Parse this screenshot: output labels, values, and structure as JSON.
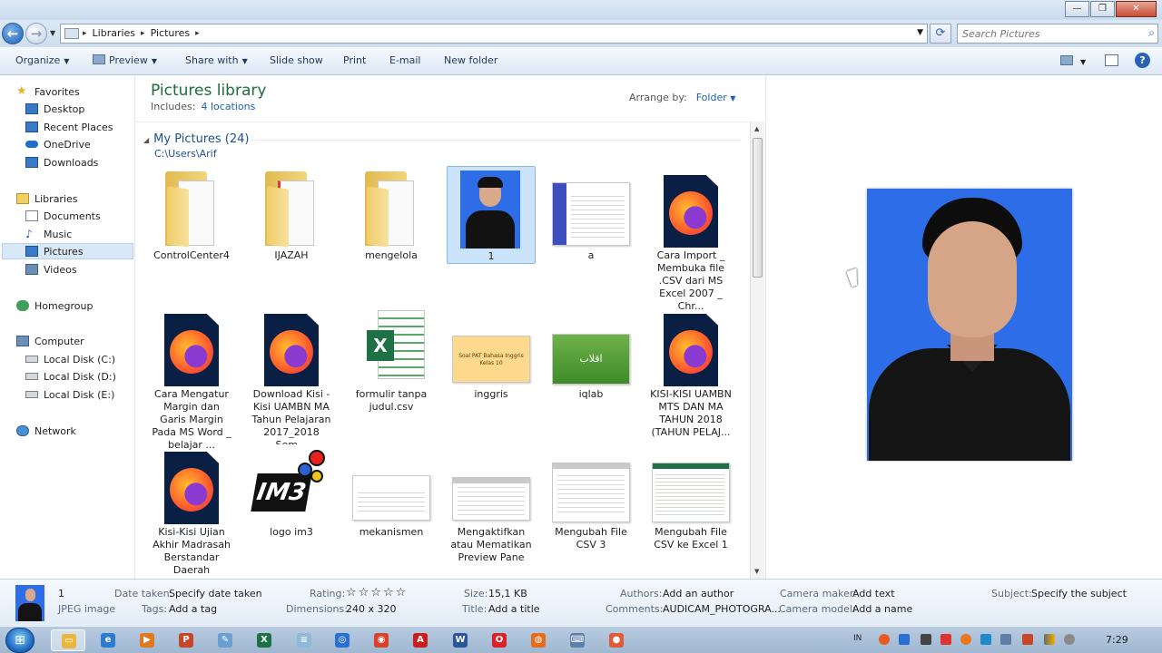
{
  "window": {
    "minimize": "—",
    "maximize": "❐",
    "close": "✕"
  },
  "address": {
    "crumbs": [
      "Libraries",
      "Pictures"
    ],
    "search_placeholder": "Search Pictures"
  },
  "toolbar": {
    "organize": "Organize",
    "preview": "Preview",
    "share_with": "Share with",
    "slide_show": "Slide show",
    "print": "Print",
    "email": "E-mail",
    "new_folder": "New folder",
    "help": "?"
  },
  "navpane": {
    "favorites": "Favorites",
    "desktop": "Desktop",
    "recent_places": "Recent Places",
    "onedrive": "OneDrive",
    "downloads": "Downloads",
    "libraries": "Libraries",
    "documents": "Documents",
    "music": "Music",
    "pictures": "Pictures",
    "videos": "Videos",
    "homegroup": "Homegroup",
    "computer": "Computer",
    "disk_c": "Local Disk (C:)",
    "disk_d": "Local Disk (D:)",
    "disk_e": "Local Disk (E:)",
    "network": "Network"
  },
  "content": {
    "title": "Pictures library",
    "includes_label": "Includes:",
    "includes_link": "4 locations",
    "arrange_label": "Arrange by:",
    "arrange_value": "Folder",
    "group_title": "My Pictures (24)",
    "group_path": "C:\\Users\\Arif",
    "files": [
      {
        "name": "ControlCenter4",
        "type": "folder"
      },
      {
        "name": "IJAZAH",
        "type": "folder"
      },
      {
        "name": "mengelola",
        "type": "folder"
      },
      {
        "name": "1",
        "type": "photo"
      },
      {
        "name": "a",
        "type": "screenshot"
      },
      {
        "name": "Cara Import _ Membuka file .CSV dari MS Excel 2007 _ Chr...",
        "type": "firefox"
      },
      {
        "name": "Cara Mengatur Margin dan Garis Margin Pada MS Word _ belajar ...",
        "type": "firefox"
      },
      {
        "name": "Download Kisi - Kisi UAMBN MA Tahun Pelajaran 2017_2018 Sem...",
        "type": "firefox"
      },
      {
        "name": "formulir tanpa judul.csv",
        "type": "excel"
      },
      {
        "name": "inggris",
        "type": "image"
      },
      {
        "name": "iqlab",
        "type": "image"
      },
      {
        "name": "KISI-KISI UAMBN MTS DAN MA TAHUN 2018 (TAHUN PELAJ...",
        "type": "firefox"
      },
      {
        "name": "Kisi-Kisi Ujian Akhir Madrasah Berstandar Daerah (UAMB...",
        "type": "firefox"
      },
      {
        "name": "logo im3",
        "type": "logo"
      },
      {
        "name": "mekanismen",
        "type": "image"
      },
      {
        "name": "Mengaktifkan atau Mematikan Preview Pane",
        "type": "screenshot"
      },
      {
        "name": "Mengubah File CSV 3",
        "type": "screenshot"
      },
      {
        "name": "Mengubah File CSV ke Excel 1",
        "type": "screenshot"
      }
    ],
    "inggris_text": "Soal PAT Bahasa Inggris Kelas 10",
    "iqlab_text": "اقلاب",
    "im3_text": "IM3"
  },
  "details": {
    "name": "1",
    "filetype": "JPEG image",
    "date_taken_label": "Date taken:",
    "date_taken_value": "Specify date taken",
    "tags_label": "Tags:",
    "tags_value": "Add a tag",
    "rating_label": "Rating:",
    "rating_value": "☆☆☆☆☆",
    "dimensions_label": "Dimensions:",
    "dimensions_value": "240 x 320",
    "size_label": "Size:",
    "size_value": "15,1 KB",
    "title_label": "Title:",
    "title_value": "Add a title",
    "authors_label": "Authors:",
    "authors_value": "Add an author",
    "comments_label": "Comments:",
    "comments_value": "AUDICAM_PHOTOGRA...",
    "camera_maker_label": "Camera maker:",
    "camera_maker_value": "Add text",
    "camera_model_label": "Camera model:",
    "camera_model_value": "Add a name",
    "subject_label": "Subject:",
    "subject_value": "Specify the subject"
  },
  "taskbar": {
    "lang": "IN",
    "clock": "7:29",
    "apps": [
      {
        "name": "explorer",
        "glyph": "▭",
        "color": "#e8b73c"
      },
      {
        "name": "ie",
        "glyph": "e",
        "color": "#2b7bd3"
      },
      {
        "name": "media",
        "glyph": "▶",
        "color": "#e07a1f"
      },
      {
        "name": "powerpoint",
        "glyph": "P",
        "color": "#c9452a"
      },
      {
        "name": "paint",
        "glyph": "✎",
        "color": "#6a9fd1"
      },
      {
        "name": "excel",
        "glyph": "X",
        "color": "#1e7145"
      },
      {
        "name": "notepad",
        "glyph": "≡",
        "color": "#8fb9d9"
      },
      {
        "name": "chrome-blue",
        "glyph": "◎",
        "color": "#2a6fd1"
      },
      {
        "name": "chrome",
        "glyph": "◉",
        "color": "#d9412f"
      },
      {
        "name": "acrobat",
        "glyph": "A",
        "color": "#c91e1e"
      },
      {
        "name": "word",
        "glyph": "W",
        "color": "#2b579a"
      },
      {
        "name": "opera",
        "glyph": "O",
        "color": "#d8232a"
      },
      {
        "name": "firefox",
        "glyph": "◍",
        "color": "#e66b1d"
      },
      {
        "name": "keyboard",
        "glyph": "⌨",
        "color": "#5d7fa8"
      },
      {
        "name": "recorder",
        "glyph": "●",
        "color": "#e25a3a"
      }
    ]
  }
}
